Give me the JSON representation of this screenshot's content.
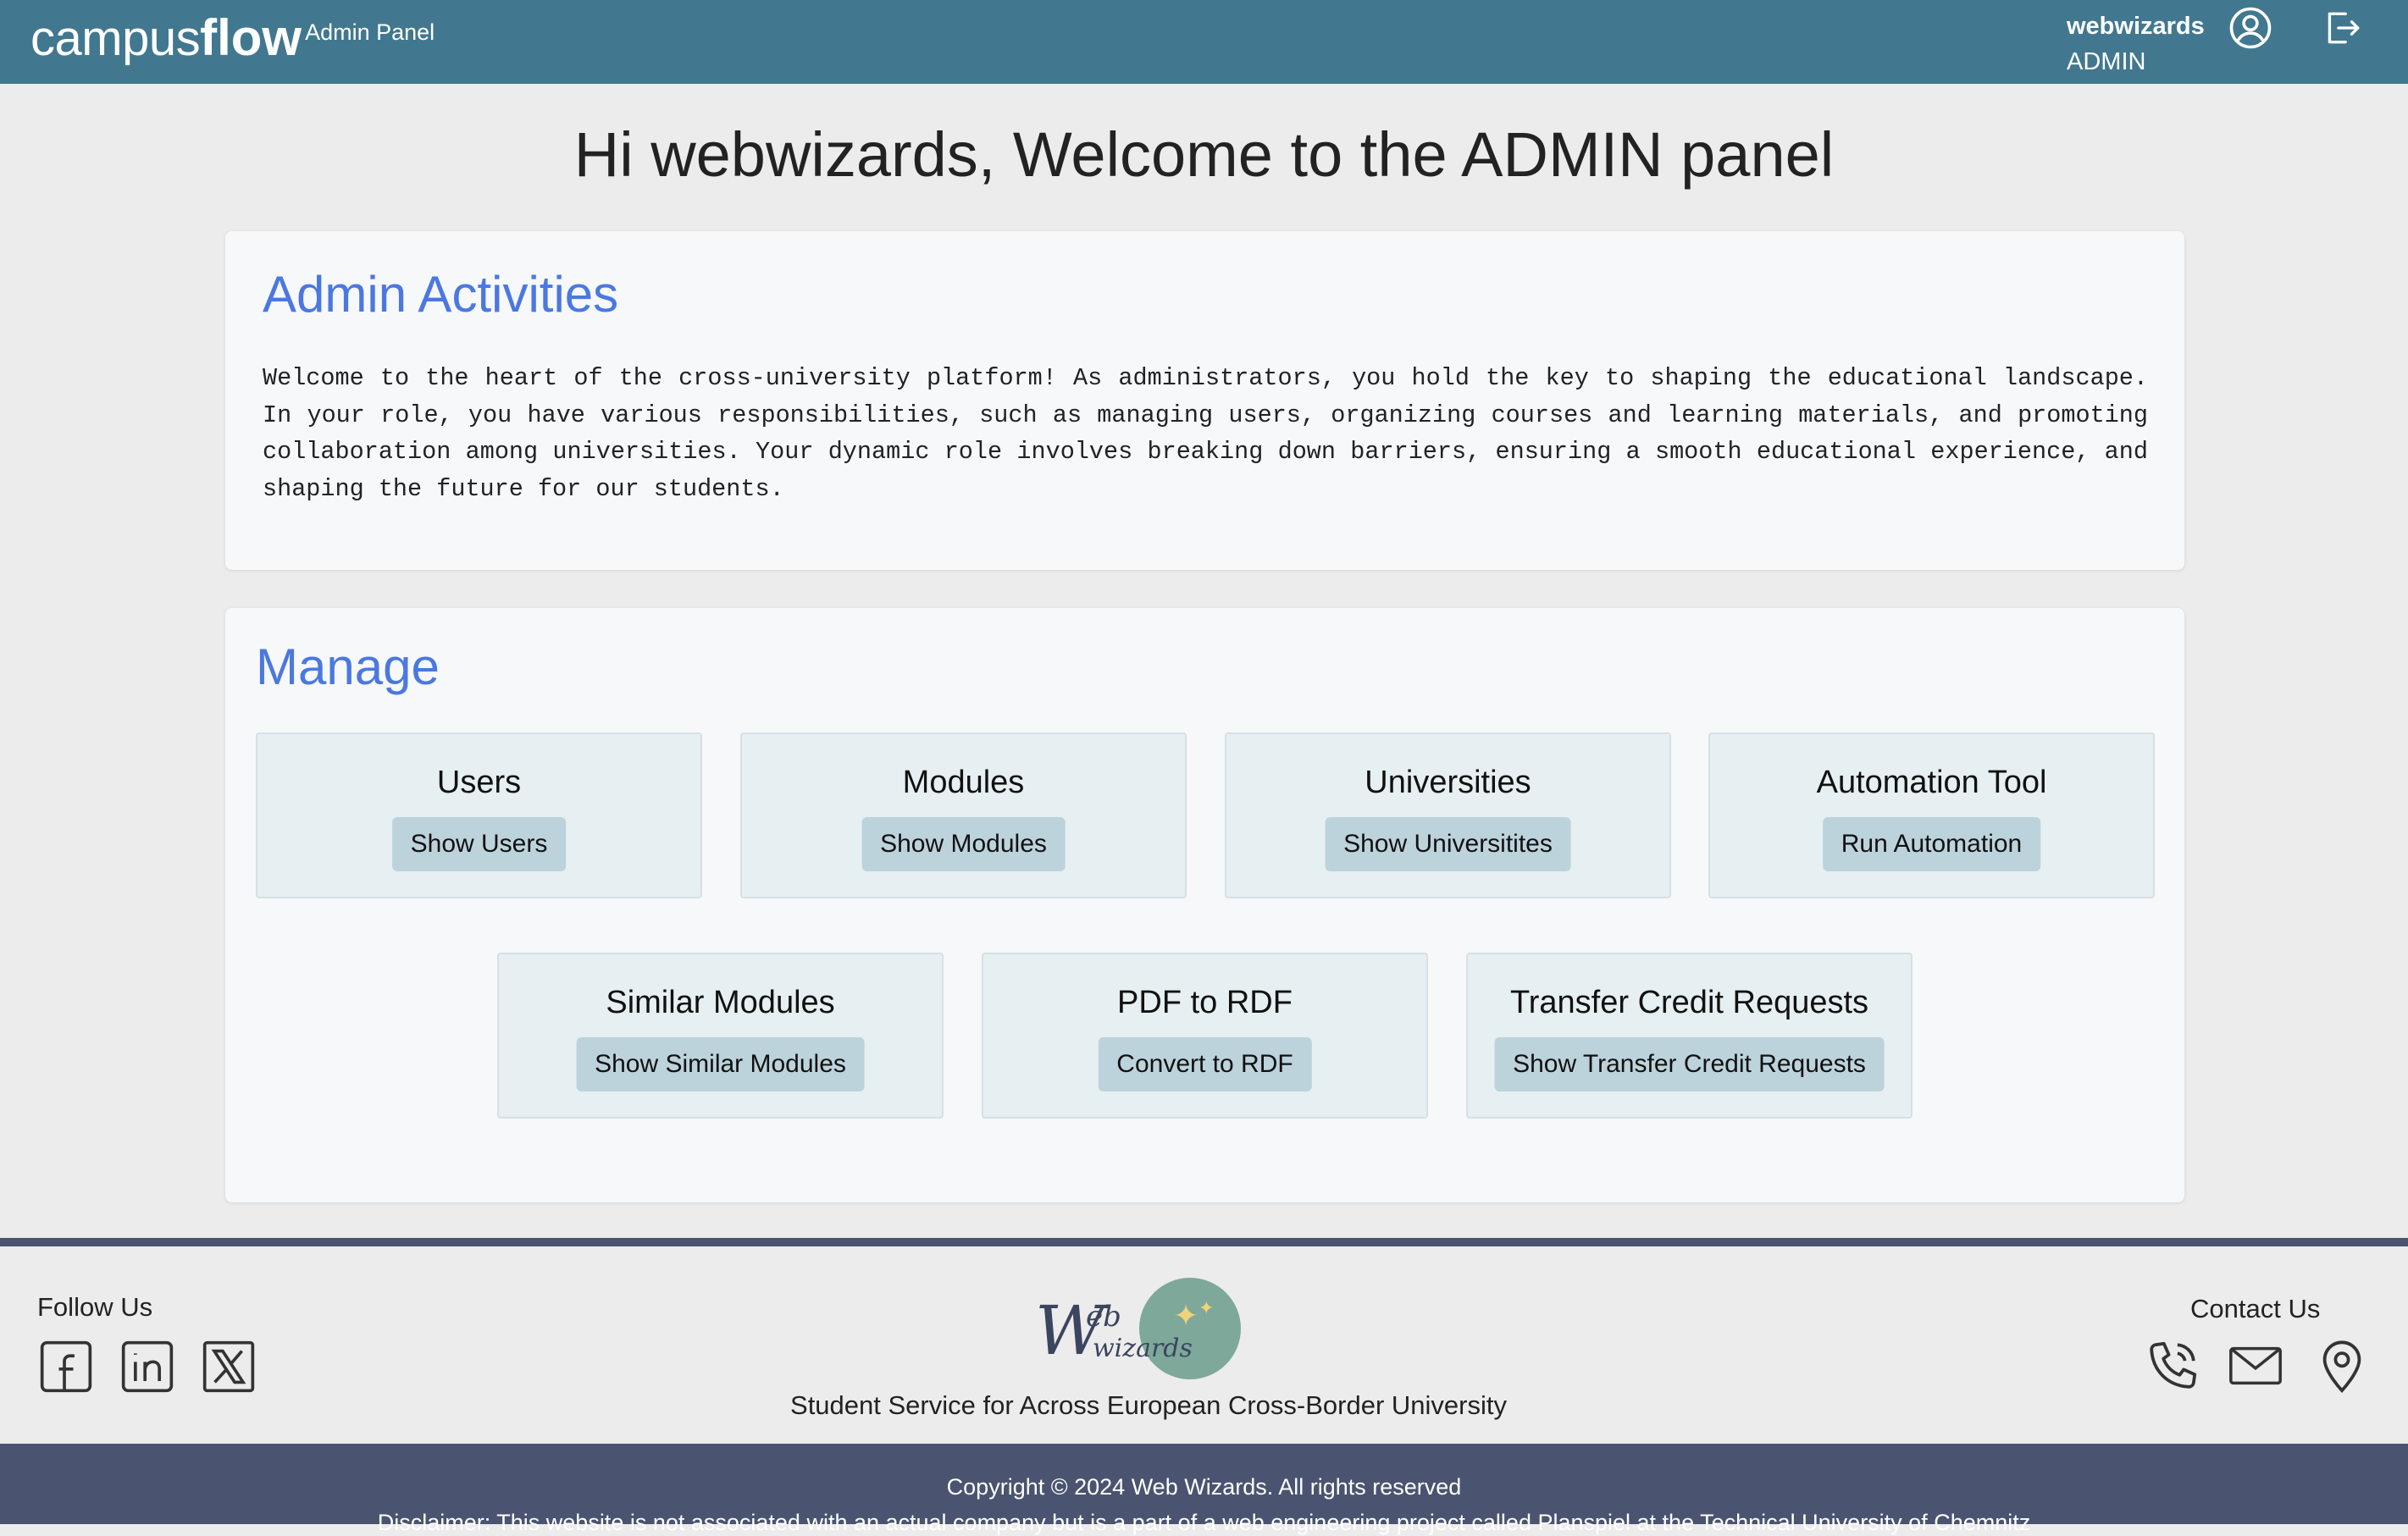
{
  "header": {
    "brand_prefix": "campus",
    "brand_suffix": "flow",
    "brand_subtitle": "Admin Panel",
    "username": "webwizards",
    "role": "ADMIN",
    "user_icon": "user-circle-icon",
    "logout_icon": "logout-icon"
  },
  "welcome": "Hi webwizards, Welcome to the ADMIN panel",
  "activities": {
    "title": "Admin Activities",
    "text": "Welcome to the heart of the cross-university platform! As administrators, you hold the key to shaping the educational landscape. In your role, you have various responsibilities, such as managing users, organizing courses and learning materials, and promoting collaboration among universities. Your dynamic role involves breaking down barriers, ensuring a smooth educational experience, and shaping the future for our students."
  },
  "manage": {
    "title": "Manage",
    "tiles": [
      {
        "title": "Users",
        "button": "Show Users"
      },
      {
        "title": "Modules",
        "button": "Show Modules"
      },
      {
        "title": "Universities",
        "button": "Show Universitites"
      },
      {
        "title": "Automation Tool",
        "button": "Run Automation"
      },
      {
        "title": "Similar Modules",
        "button": "Show Similar Modules"
      },
      {
        "title": "PDF to RDF",
        "button": "Convert to RDF"
      },
      {
        "title": "Transfer Credit Requests",
        "button": "Show Transfer Credit Requests"
      }
    ]
  },
  "footer": {
    "follow_label": "Follow Us",
    "social_icons": [
      "facebook-icon",
      "linkedin-icon",
      "x-icon"
    ],
    "logo_text": "Web wizards",
    "tagline": "Student Service for Across European Cross-Border University",
    "contact_label": "Contact Us",
    "contact_icons": [
      "phone-icon",
      "mail-icon",
      "location-pin-icon"
    ],
    "copyright": "Copyright © 2024 Web Wizards. All rights reserved",
    "disclaimer": "Disclaimer: This website is not associated with an actual company but is a part of a web engineering project called Planspiel at the Technical University of Chemnitz"
  },
  "colors": {
    "header_bg": "#41788f",
    "accent_title": "#4b78e0",
    "tile_bg": "#e6eff2",
    "button_bg": "#bcd3dc",
    "footer_bar": "#4a5470"
  }
}
